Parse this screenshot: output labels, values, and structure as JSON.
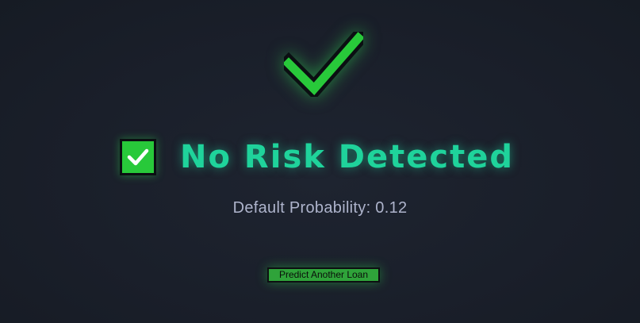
{
  "result": {
    "status_icon": "check-mark-icon",
    "title": "No Risk Detected",
    "title_icon": "check-box-icon",
    "probability_text": "Default Probability: 0.12",
    "accent_color": "#1fd39b",
    "check_color": "#28c93a"
  },
  "actions": {
    "predict_again_label": "Predict Another Loan"
  }
}
